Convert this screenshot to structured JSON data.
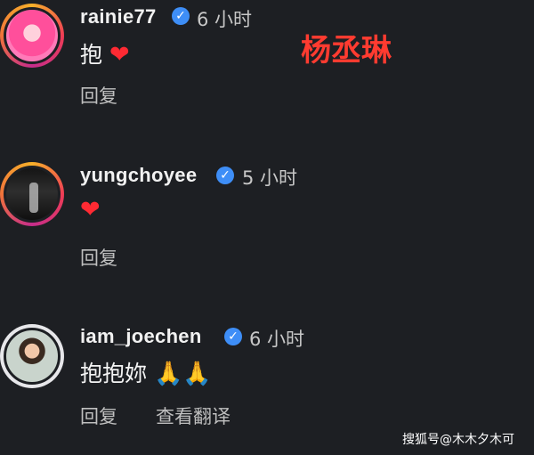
{
  "overlay_tag": "杨丞琳",
  "watermark": "搜狐号@木木夕木可",
  "comments": [
    {
      "username": "rainie77",
      "time": "6 小时",
      "text": "抱",
      "emoji": "❤",
      "reply": "回复"
    },
    {
      "username": "yungchoyee",
      "time": "5 小时",
      "emoji": "❤",
      "reply": "回复"
    },
    {
      "username": "iam_joechen",
      "time": "6 小时",
      "text": "抱抱妳",
      "emoji": "🙏🙏",
      "reply": "回复",
      "translate": "查看翻译"
    }
  ],
  "icons": {
    "verified": "verified-badge-icon"
  },
  "colors": {
    "background": "#1d1f23",
    "verified": "#3e8ef7",
    "tag": "#ff3b30",
    "heart": "#ff2a33"
  }
}
